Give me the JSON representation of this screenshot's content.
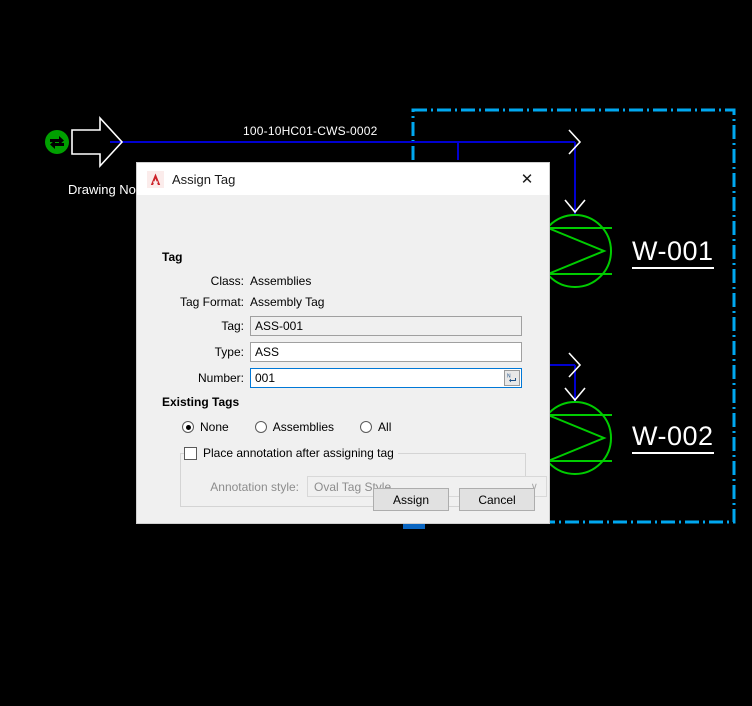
{
  "canvas": {
    "background_color": "#000000",
    "pipe_color": "#0000cc",
    "selection_color": "#00aaff",
    "equipment_color": "#00cc00",
    "annotation_color": "#ffffff",
    "pipe_tag_label": "100-10HC01-CWS-0002",
    "drawing_no_label": "Drawing No",
    "off_page_connector_icon": "off-page-connector-icon",
    "flow_arrow_icon": "flow-arrow-icon",
    "equipment": [
      {
        "label": "W-001",
        "symbol_icon": "heat-exchanger-symbol-icon"
      },
      {
        "label": "W-002",
        "symbol_icon": "heat-exchanger-symbol-icon"
      }
    ]
  },
  "dialog": {
    "title": "Assign Tag",
    "logo_icon": "autocad-logo-icon",
    "close_icon": "close-icon",
    "tag_section": {
      "title": "Tag",
      "class_label": "Class:",
      "class_value": "Assemblies",
      "tag_format_label": "Tag Format:",
      "tag_format_value": "Assembly Tag",
      "tag_label": "Tag:",
      "tag_value": "ASS-001",
      "type_label": "Type:",
      "type_value": "ASS",
      "number_label": "Number:",
      "number_value": "001",
      "number_spinner_icon": "auto-number-icon"
    },
    "existing_tags_section": {
      "title": "Existing Tags",
      "options": [
        {
          "label": "None",
          "selected": true
        },
        {
          "label": "Assemblies",
          "selected": false
        },
        {
          "label": "All",
          "selected": false
        }
      ],
      "place_annotation_label": "Place annotation after assigning tag",
      "place_annotation_checked": false,
      "annotation_style_label": "Annotation style:",
      "annotation_style_value": "Oval Tag Style",
      "annotation_style_chevron": "∨"
    },
    "footer": {
      "assign_label": "Assign",
      "cancel_label": "Cancel"
    },
    "accent_color": "#0078d7"
  }
}
